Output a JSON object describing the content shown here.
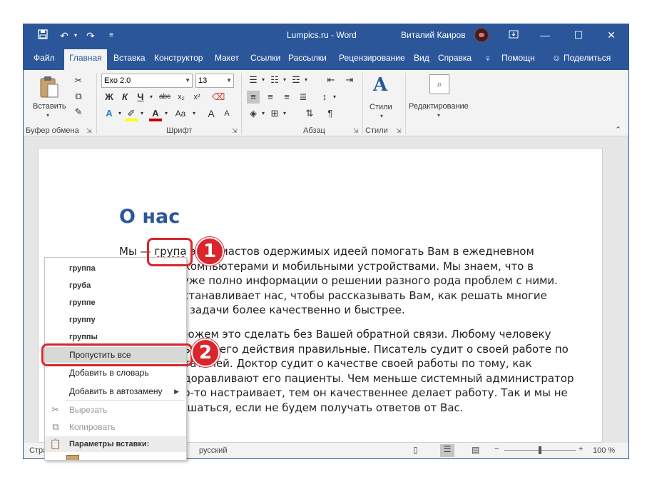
{
  "window": {
    "title": "Lumpics.ru  -  Word",
    "user": "Виталий Каиров"
  },
  "quick_access": [
    "save-icon",
    "undo-icon",
    "redo-icon",
    "customize-icon"
  ],
  "ribbon_tabs": [
    "Файл",
    "Главная",
    "Вставка",
    "Конструктор",
    "Макет",
    "Ссылки",
    "Рассылки",
    "Рецензирование",
    "Вид",
    "Справка",
    "Помощн",
    "Поделиться"
  ],
  "ribbon": {
    "paste_label": "Вставить",
    "font_name": "Exo 2.0",
    "font_size": "13",
    "bold": "Ж",
    "italic": "К",
    "underline": "Ч",
    "strike": "abc",
    "subscript": "x₂",
    "superscript": "x²",
    "font_grow": "A",
    "change_case": "Aa",
    "styles_label": "Стили",
    "editing_label": "Редактирование",
    "groups": {
      "clipboard": "Буфер обмена",
      "font": "Шрифт",
      "paragraph": "Абзац",
      "styles": "Стили"
    }
  },
  "document": {
    "heading": "О нас",
    "p1_before": "Мы — ",
    "p1_word": "група",
    "p1_after": " энтузиастов одержимых идеей помогать Вам в ежедневном контакте с компьютерами и мобильными устройствами. Мы знаем, что в интернете уже полно информации о решении разного рода проблем с ними. Но это не останавливает нас, чтобы рассказывать Вам, как решать многие проблемы и задачи более качественно и быстрее.",
    "p2": "Но мы не сможем это сделать без Вашей обратной связи. Любому человеку важно знать, что его действия правильные. Писатель судит о своей работе по отзывам читателей. Доктор судит о качестве своей работы по тому, как быстро выздоравливают его пациенты. Чем меньше системный администратор бегает и что-то настраивает, тем он качественнее делает работу. Так и мы не можем улучшаться, если не будем получать ответов от Вас."
  },
  "context_menu": {
    "suggestions": [
      "группа",
      "груба",
      "группе",
      "группу",
      "группы"
    ],
    "ignore_all": "Пропустить все",
    "add_to_dictionary": "Добавить в словарь",
    "add_to_autocorrect": "Добавить в автозамену",
    "cut": "Вырезать",
    "copy": "Копировать",
    "paste_options": "Параметры вставки:"
  },
  "status": {
    "page_partial": "Стра",
    "language": "русский",
    "zoom": "100 %"
  },
  "callouts": [
    "1",
    "2"
  ],
  "colors": {
    "accent": "#2b579a",
    "callout": "#d9252b",
    "misspell": "#d00000"
  }
}
